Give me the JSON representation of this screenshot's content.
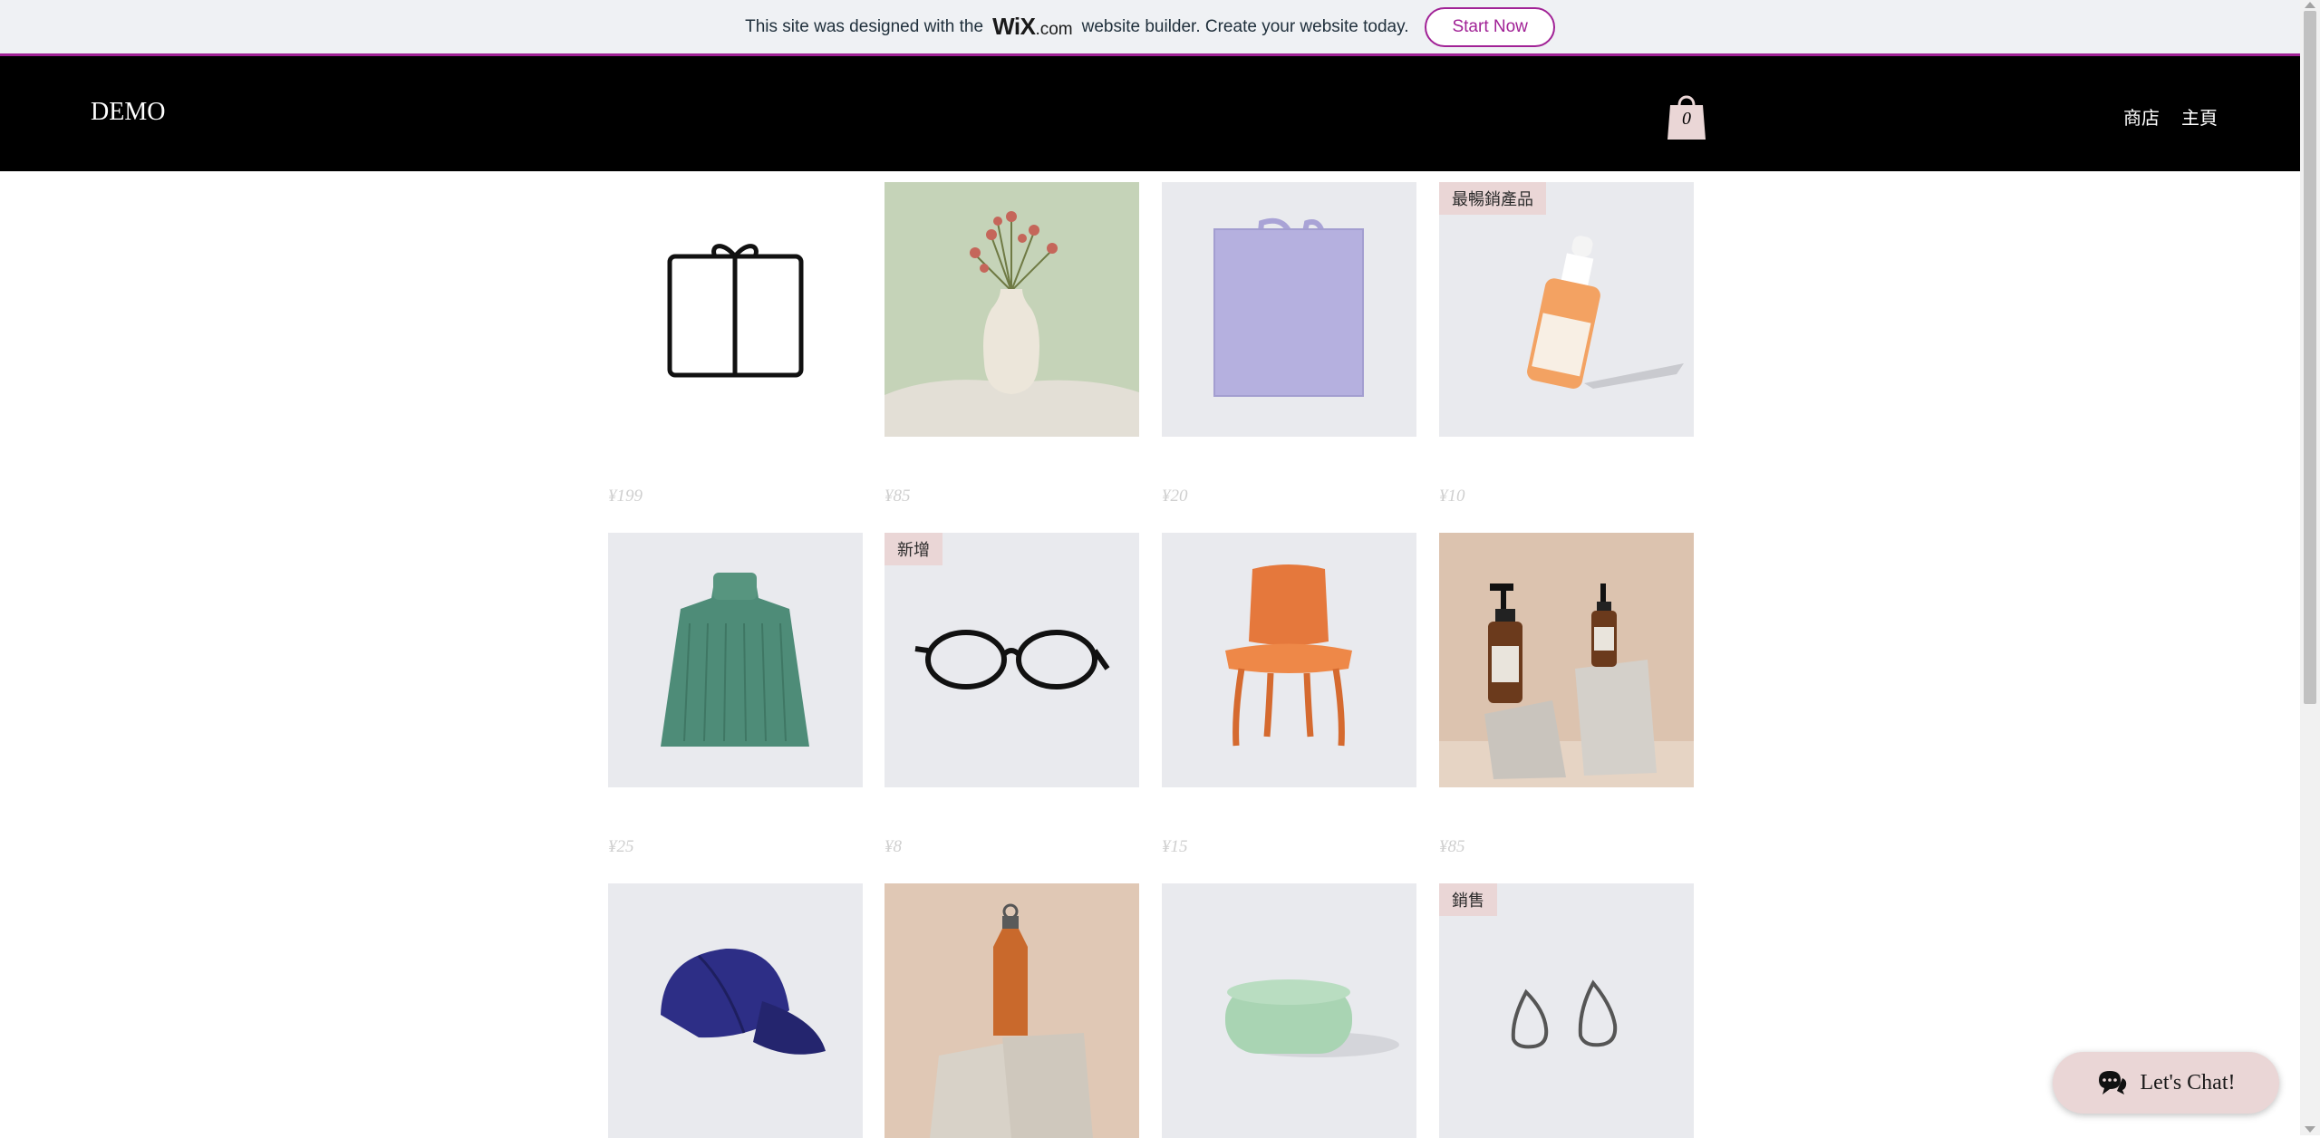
{
  "banner": {
    "text_before": "This site was designed with the",
    "logo_main": "WiX",
    "logo_suffix": ".com",
    "text_after": "website builder. Create your website today.",
    "button": "Start Now",
    "accent": "#a12296"
  },
  "header": {
    "brand": "DEMO",
    "cart_count": "0",
    "nav": [
      "商店",
      "主頁"
    ]
  },
  "products": [
    {
      "icon": "gift-icon",
      "ribbon": "",
      "price": "¥199"
    },
    {
      "icon": "vase-image",
      "ribbon": "",
      "price": "¥85"
    },
    {
      "icon": "tote-bag-image",
      "ribbon": "",
      "price": "¥20"
    },
    {
      "icon": "serum-bottle-image",
      "ribbon": "最暢銷產品",
      "price": "¥10"
    },
    {
      "icon": "sweater-image",
      "ribbon": "",
      "price": "¥25"
    },
    {
      "icon": "glasses-image",
      "ribbon": "新增",
      "price": "¥8"
    },
    {
      "icon": "chair-image",
      "ribbon": "",
      "price": "¥15"
    },
    {
      "icon": "pump-bottles-image",
      "ribbon": "",
      "price": "¥85"
    },
    {
      "icon": "cap-image",
      "ribbon": "",
      "price": ""
    },
    {
      "icon": "water-bottle-image",
      "ribbon": "",
      "price": ""
    },
    {
      "icon": "soap-image",
      "ribbon": "",
      "price": ""
    },
    {
      "icon": "earrings-image",
      "ribbon": "銷售",
      "price": ""
    }
  ],
  "chat": {
    "label": "Let's Chat!",
    "icon": "chat-bubble-icon"
  }
}
